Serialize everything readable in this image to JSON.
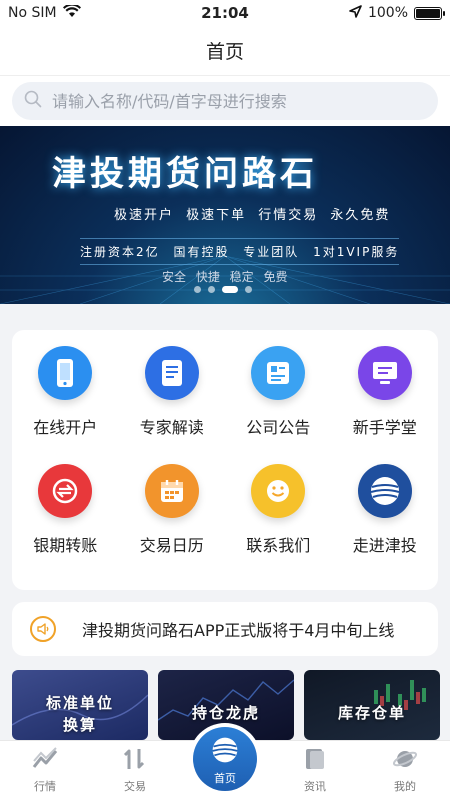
{
  "status": {
    "carrier": "No SIM",
    "time": "21:04",
    "battery": "100%"
  },
  "navbar": {
    "title": "首页"
  },
  "search": {
    "placeholder": "请输入名称/代码/首字母进行搜索"
  },
  "banner": {
    "title": "津投期货问路石",
    "line1": "极速开户 极速下单 行情交易 永久免费",
    "line2": "注册资本2亿 国有控股 专业团队 1对1VIP服务",
    "line3": "安全 快捷 稳定 免费",
    "active_slide": 2,
    "slide_count": 4
  },
  "grid": [
    {
      "label": "在线开户",
      "icon": "phone-icon",
      "color": "#2b8ff0"
    },
    {
      "label": "专家解读",
      "icon": "document-icon",
      "color": "#2d6fe4"
    },
    {
      "label": "公司公告",
      "icon": "notice-icon",
      "color": "#3aa2f2"
    },
    {
      "label": "新手学堂",
      "icon": "monitor-icon",
      "color": "#7a46e8"
    },
    {
      "label": "银期转账",
      "icon": "transfer-icon",
      "color": "#e8383b"
    },
    {
      "label": "交易日历",
      "icon": "calendar-icon",
      "color": "#f2942c"
    },
    {
      "label": "联系我们",
      "icon": "smile-icon",
      "color": "#f6c12b"
    },
    {
      "label": "走进津投",
      "icon": "globe-icon",
      "color": "#1f4f9e"
    }
  ],
  "notice": {
    "text": "津投期货问路石APP正式版将于4月中旬上线"
  },
  "cards": [
    {
      "label": "标准单位换算",
      "line1": "标准单位",
      "line2": "换算"
    },
    {
      "label": "持仓龙虎"
    },
    {
      "label": "库存仓单"
    }
  ],
  "tabbar": [
    {
      "label": "行情",
      "icon": "chart-icon"
    },
    {
      "label": "交易",
      "icon": "trade-icon"
    },
    {
      "label": "首页",
      "icon": "home-globe-icon"
    },
    {
      "label": "资讯",
      "icon": "news-icon"
    },
    {
      "label": "我的",
      "icon": "planet-icon"
    }
  ],
  "colors": {
    "accent": "#2a6fd0",
    "notice_icon": "#f0a228"
  }
}
